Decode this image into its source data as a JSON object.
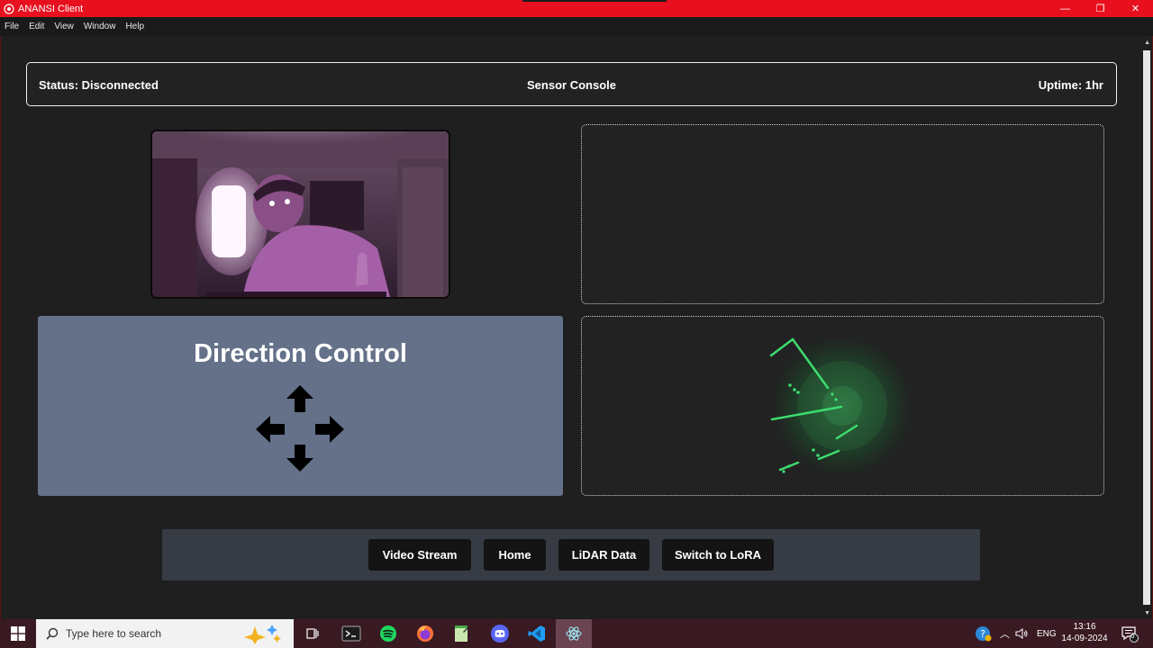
{
  "window": {
    "title": "ANANSI Client",
    "controls": {
      "minimize": "—",
      "maximize": "❐",
      "close": "✕"
    }
  },
  "menu": [
    "File",
    "Edit",
    "View",
    "Window",
    "Help"
  ],
  "header": {
    "status": "Status: Disconnected",
    "title": "Sensor Console",
    "uptime": "Uptime: 1hr"
  },
  "direction_control": {
    "title": "Direction Control",
    "arrows": [
      "up-arrow-icon",
      "left-arrow-icon",
      "right-arrow-icon",
      "down-arrow-icon"
    ]
  },
  "nav": {
    "buttons": [
      "Video Stream",
      "Home",
      "LiDAR Data",
      "Switch to LoRA"
    ]
  },
  "taskbar": {
    "search_placeholder": "Type here to search",
    "apps": [
      "task-view-icon",
      "terminal-icon",
      "spotify-icon",
      "firefox-icon",
      "notepad-icon",
      "discord-icon",
      "vscode-icon",
      "electron-app-icon"
    ],
    "tray": {
      "language": "ENG",
      "time": "13:16",
      "date": "14-09-2024",
      "notifications": "6"
    }
  },
  "colors": {
    "titlebar": "#e8101e",
    "background": "#1f1f1f",
    "direction_panel": "#647189",
    "nav_bar": "#363b44",
    "lidar_points": "#3ddc6e"
  }
}
